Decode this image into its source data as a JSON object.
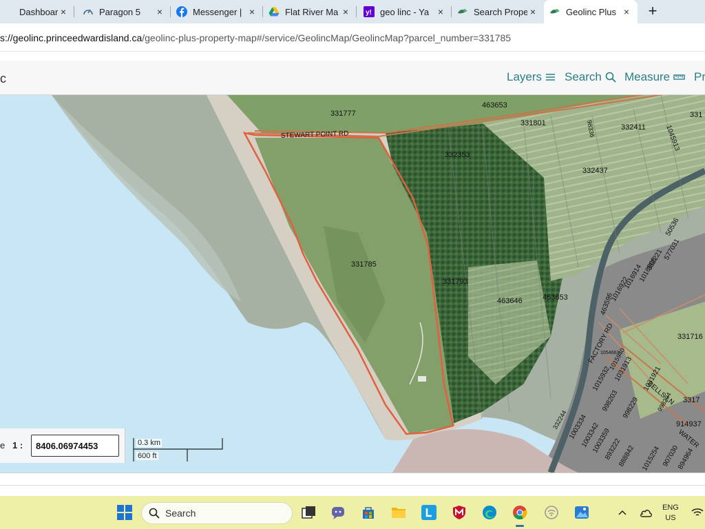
{
  "browser": {
    "tabs": [
      {
        "title": "Dashboard |",
        "icon": "dashboard-icon"
      },
      {
        "title": "Paragon 5",
        "icon": "gauge-icon"
      },
      {
        "title": "Messenger |",
        "icon": "facebook-icon"
      },
      {
        "title": "Flat River Ma",
        "icon": "google-drive-icon"
      },
      {
        "title": "geo linc - Ya",
        "icon": "yahoo-icon"
      },
      {
        "title": "Search Prope",
        "icon": "geolinc-icon"
      },
      {
        "title": "Geolinc Plus",
        "icon": "geolinc-icon"
      }
    ],
    "tab_close": "×",
    "new_tab": "+",
    "url_host": "s://geolinc.princeedwardisland.ca",
    "url_path": "/geolinc-plus-property-map#/service/GeolincMap/GeolincMap?parcel_number=331785"
  },
  "app": {
    "brand": "c",
    "nav": {
      "layers": "Layers",
      "search": "Search",
      "measure": "Measure",
      "print": "Pr"
    }
  },
  "map": {
    "road_label": "STEWART POINT RD",
    "factory_road_label": "FACTORY RD",
    "bells_label": "BELLS LN",
    "water_label": "WATER",
    "selected_parcel": "331785",
    "parcels": {
      "p1": "331777",
      "p2": "463653",
      "p3": "331801",
      "p4": "332411",
      "p5": "332353",
      "p6": "332437",
      "p7": "331785",
      "p8": "331793",
      "p9": "463646",
      "p10": "463653",
      "p11": "331716",
      "p12": "331",
      "p13": "1045913",
      "p14": "98336",
      "p15": "50536",
      "p16": "577031",
      "p17": "332221",
      "p18": "1016914",
      "p19": "1016906",
      "p20": "1016922",
      "p21": "463596",
      "p22": "1054663",
      "p23": "1031913",
      "p24": "1015932",
      "p25": "998203",
      "p26": "1003334",
      "p27": "1003342",
      "p28": "1003359",
      "p29": "893222",
      "p30": "888842",
      "p31": "914937",
      "p32": "907030",
      "p33": "1015254",
      "p34": "894964",
      "p35": "3317",
      "p36": "998229",
      "p37": "1031921",
      "p38": "332244",
      "p39": "1015940",
      "p40": "998294"
    },
    "scale_label_partial": "e",
    "scale_prefix": "1 :",
    "scale_value": "8406.06974453",
    "scalebar_km": "0.3 km",
    "scalebar_ft": "600 ft"
  },
  "taskbar": {
    "search_placeholder": "Search",
    "lang_line1": "ENG",
    "lang_line2": "US"
  }
}
